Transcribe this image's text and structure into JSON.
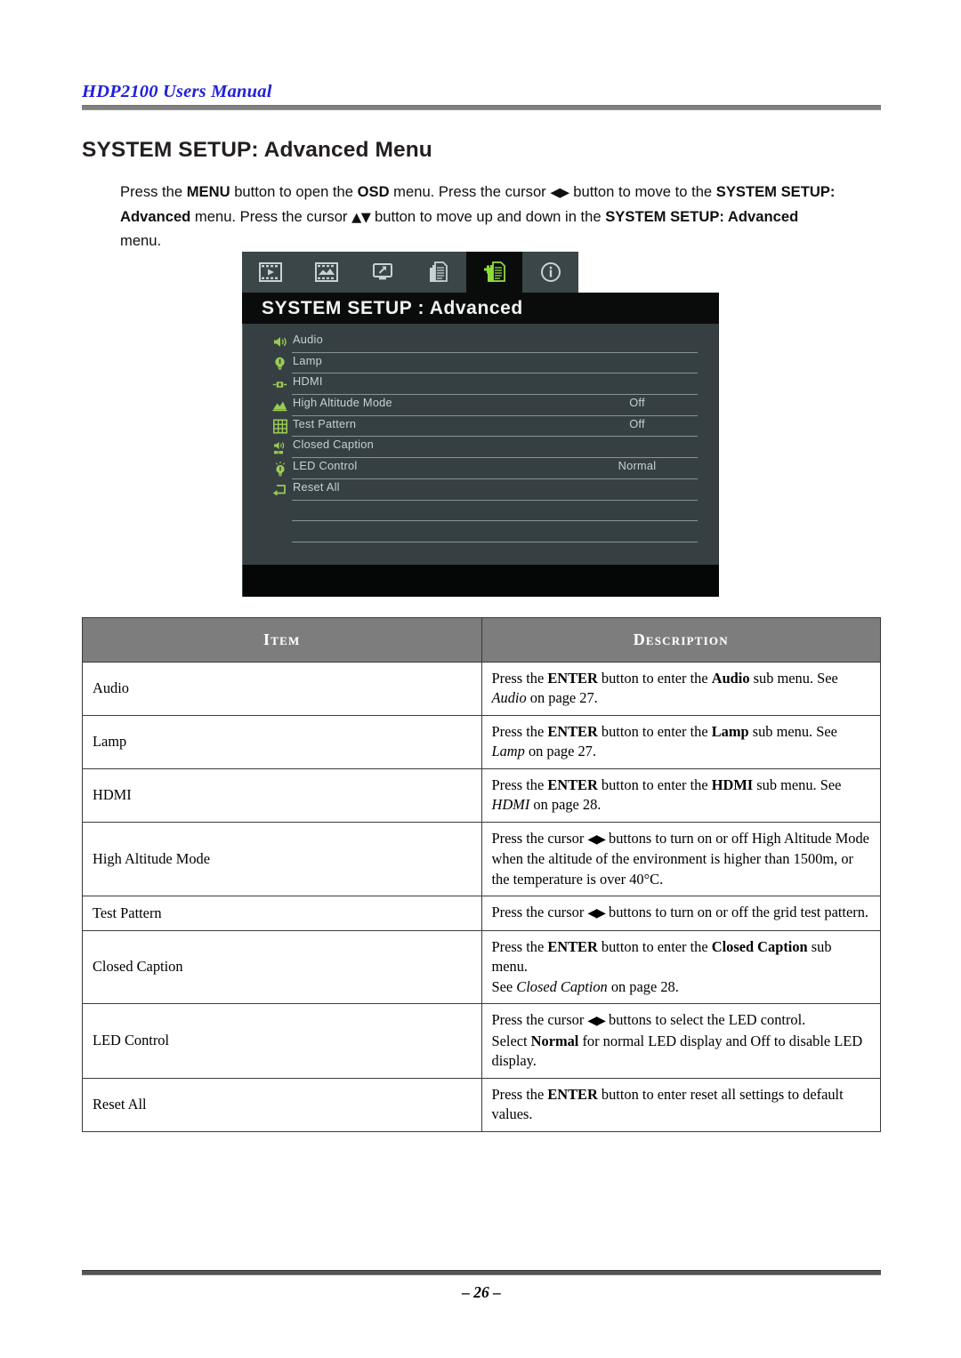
{
  "header": {
    "running_title": "HDP2100 Users Manual"
  },
  "section": {
    "heading": "SYSTEM SETUP: Advanced Menu"
  },
  "intro": {
    "line1_a": "Press the ",
    "line1_menu": "MENU",
    "line1_b": " button to open the ",
    "line1_osd": "OSD",
    "line1_c": " menu. Press the cursor ",
    "line1_arrows": "◀▶",
    "line1_d": " button to move to the ",
    "line2_setup": "SYSTEM SETUP: Advanced",
    "line2_a": " menu. Press the cursor ",
    "line2_arrows": "▲▼",
    "line2_b": " button to move up and down in the ",
    "line3_setup": "SYSTEM SETUP: Advanced",
    "line3_a": " menu."
  },
  "osd": {
    "title": "SYSTEM SETUP : Advanced",
    "tabs": [
      {
        "name": "image-tab",
        "icon": "film-strip-icon",
        "active": false
      },
      {
        "name": "computer-image-tab",
        "icon": "picture-icon",
        "active": false
      },
      {
        "name": "installation-tab",
        "icon": "monitor-arrow-icon",
        "active": false
      },
      {
        "name": "system-setup-basic-tab",
        "icon": "document-pages-icon",
        "active": false
      },
      {
        "name": "system-setup-advanced-tab",
        "icon": "document-plus-icon",
        "active": true
      },
      {
        "name": "information-tab",
        "icon": "info-circle-icon",
        "active": false
      }
    ],
    "rows": [
      {
        "label": "Audio",
        "value": "",
        "icon": "speaker-icon"
      },
      {
        "label": "Lamp",
        "value": "",
        "icon": "lamp-bulb-icon"
      },
      {
        "label": "HDMI",
        "value": "",
        "icon": "hdmi-connector-icon"
      },
      {
        "label": "High Altitude Mode",
        "value": "Off",
        "icon": "altitude-mountain-icon"
      },
      {
        "label": "Test Pattern",
        "value": "Off",
        "icon": "grid-icon"
      },
      {
        "label": "Closed Caption",
        "value": "",
        "icon": "closed-caption-icon"
      },
      {
        "label": "LED Control",
        "value": "Normal",
        "icon": "led-bulb-icon"
      },
      {
        "label": "Reset All",
        "value": "",
        "icon": "reset-arrow-icon"
      }
    ],
    "colors": {
      "tabbar_bg": "#3a4648",
      "titlebar_bg": "#0a0c0b",
      "body_bg": "#364043",
      "accent_green": "#8ddc3c",
      "text": "#c3d2d6"
    }
  },
  "table": {
    "headers": {
      "item": "Item",
      "description": "Description"
    },
    "rows": [
      {
        "item": "Audio",
        "desc_parts": [
          {
            "t": "Press the ",
            "s": "n"
          },
          {
            "t": "ENTER",
            "s": "b"
          },
          {
            "t": " button to enter the ",
            "s": "n"
          },
          {
            "t": "Audio",
            "s": "b"
          },
          {
            "t": " sub menu. See ",
            "s": "n"
          },
          {
            "t": "Audio",
            "s": "i"
          },
          {
            "t": " on page 27.",
            "s": "n"
          }
        ]
      },
      {
        "item": "Lamp",
        "desc_parts": [
          {
            "t": "Press the ",
            "s": "n"
          },
          {
            "t": "ENTER",
            "s": "b"
          },
          {
            "t": " button to enter the ",
            "s": "n"
          },
          {
            "t": "Lamp",
            "s": "b"
          },
          {
            "t": " sub menu. See ",
            "s": "n"
          },
          {
            "t": "Lamp",
            "s": "i"
          },
          {
            "t": " on page 27.",
            "s": "n"
          }
        ]
      },
      {
        "item": "HDMI",
        "desc_parts": [
          {
            "t": "Press the ",
            "s": "n"
          },
          {
            "t": "ENTER",
            "s": "b"
          },
          {
            "t": " button to enter the ",
            "s": "n"
          },
          {
            "t": "HDMI",
            "s": "b"
          },
          {
            "t": " sub menu. See ",
            "s": "n"
          },
          {
            "t": "HDMI",
            "s": "i"
          },
          {
            "t": " on page 28.",
            "s": "n"
          }
        ]
      },
      {
        "item": "High Altitude Mode",
        "desc_parts": [
          {
            "t": "Press the cursor ",
            "s": "n"
          },
          {
            "t": "◀▶",
            "s": "a"
          },
          {
            "t": " buttons to turn on or off High Altitude Mode when the altitude of the environment is higher than 1500m, or the temperature is over 40°C.",
            "s": "n"
          }
        ]
      },
      {
        "item": "Test Pattern",
        "desc_parts": [
          {
            "t": "Press the cursor ",
            "s": "n"
          },
          {
            "t": "◀▶",
            "s": "a"
          },
          {
            "t": " buttons to turn on or off the grid test pattern.",
            "s": "n"
          }
        ]
      },
      {
        "item": "Closed Caption",
        "desc_parts": [
          {
            "t": "Press the ",
            "s": "n"
          },
          {
            "t": "ENTER",
            "s": "b"
          },
          {
            "t": " button to enter the ",
            "s": "n"
          },
          {
            "t": "Closed Caption",
            "s": "b"
          },
          {
            "t": " sub menu.",
            "s": "n"
          },
          {
            "t": "",
            "s": "br"
          },
          {
            "t": "See ",
            "s": "n"
          },
          {
            "t": "Closed Caption",
            "s": "i"
          },
          {
            "t": " on page 28.",
            "s": "n"
          }
        ]
      },
      {
        "item": "LED Control",
        "desc_parts": [
          {
            "t": "Press the cursor ",
            "s": "n"
          },
          {
            "t": "◀▶",
            "s": "a"
          },
          {
            "t": " buttons to select the LED control.",
            "s": "n"
          },
          {
            "t": "",
            "s": "br"
          },
          {
            "t": "Select ",
            "s": "n"
          },
          {
            "t": "Normal",
            "s": "b"
          },
          {
            "t": " for normal LED display and Off to disable LED display.",
            "s": "n"
          }
        ]
      },
      {
        "item": "Reset All",
        "desc_parts": [
          {
            "t": "Press the ",
            "s": "n"
          },
          {
            "t": "ENTER",
            "s": "b"
          },
          {
            "t": " button to enter reset all settings to default values.",
            "s": "n"
          }
        ]
      }
    ]
  },
  "footer": {
    "page_number": "– 26 –"
  }
}
